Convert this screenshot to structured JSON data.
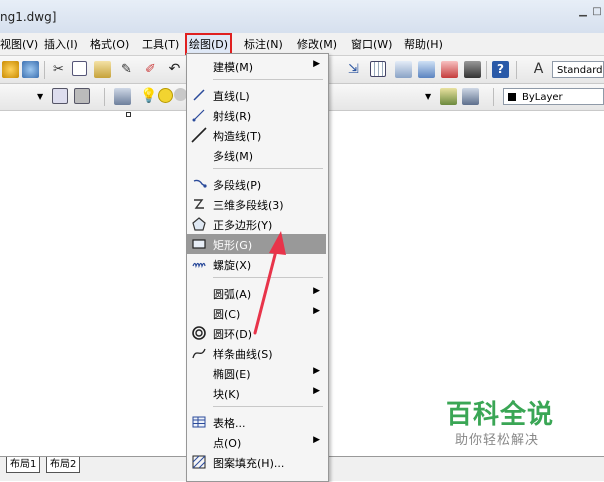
{
  "window": {
    "title": "ng1.dwg]"
  },
  "menubar": {
    "items": [
      {
        "label": "视图(V)"
      },
      {
        "label": "插入(I)"
      },
      {
        "label": "格式(O)"
      },
      {
        "label": "工具(T)"
      },
      {
        "label": "绘图(D)"
      },
      {
        "label": "标注(N)"
      },
      {
        "label": "修改(M)"
      },
      {
        "label": "窗口(W)"
      },
      {
        "label": "帮助(H)"
      }
    ]
  },
  "toolbar": {
    "text_style_value": "Standard",
    "lineweight_value": "ByLayer"
  },
  "draw_menu": {
    "items": [
      {
        "label": "建模(M)",
        "icon": "none",
        "submenu": true
      },
      {
        "label": "直线(L)",
        "icon": "line-icon"
      },
      {
        "label": "射线(R)",
        "icon": "ray-icon"
      },
      {
        "label": "构造线(T)",
        "icon": "xline-icon"
      },
      {
        "label": "多线(M)",
        "icon": "none"
      },
      {
        "label": "多段线(P)",
        "icon": "polyline-icon"
      },
      {
        "label": "三维多段线(3)",
        "icon": "3d-polyline-icon"
      },
      {
        "label": "正多边形(Y)",
        "icon": "polygon-icon"
      },
      {
        "label": "矩形(G)",
        "icon": "rectangle-icon",
        "highlighted": true
      },
      {
        "label": "螺旋(X)",
        "icon": "helix-icon"
      },
      {
        "label": "圆弧(A)",
        "icon": "none",
        "submenu": true
      },
      {
        "label": "圆(C)",
        "icon": "none",
        "submenu": true
      },
      {
        "label": "圆环(D)",
        "icon": "donut-icon"
      },
      {
        "label": "样条曲线(S)",
        "icon": "spline-icon"
      },
      {
        "label": "椭圆(E)",
        "icon": "none",
        "submenu": true
      },
      {
        "label": "块(K)",
        "icon": "none",
        "submenu": true
      },
      {
        "label": "表格...",
        "icon": "table-icon"
      },
      {
        "label": "点(O)",
        "icon": "none",
        "submenu": true
      },
      {
        "label": "图案填充(H)...",
        "icon": "hatch-icon"
      }
    ]
  },
  "layout_tabs": [
    {
      "label": "布局1"
    },
    {
      "label": "布局2"
    }
  ],
  "watermark": {
    "title": "百科全说",
    "subtitle": "助你轻松解决"
  },
  "colors": {
    "highlight": "#999999",
    "menu_active_border": "#e02020",
    "annotation_arrow": "#e8344a",
    "watermark": "#3aa655"
  }
}
